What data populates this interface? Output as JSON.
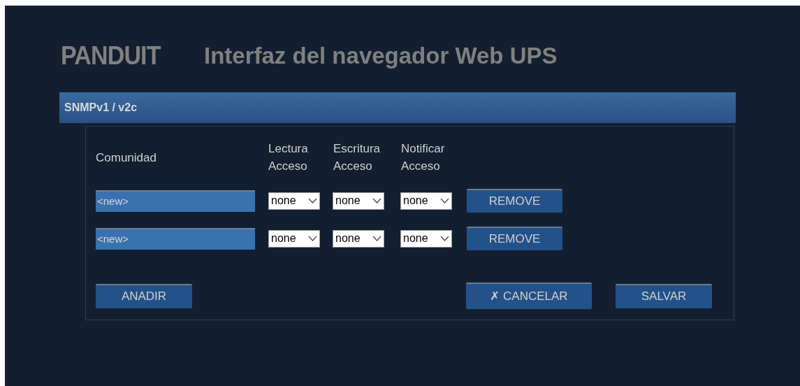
{
  "logo": "PANDUIT",
  "title": "Interfaz del navegador Web UPS",
  "section": {
    "title": "SNMPv1 / v2c"
  },
  "columns": [
    "Comunidad",
    "Lectura\nAcceso",
    "Escritura\nAcceso",
    "Notificar\nAcceso"
  ],
  "rows": [
    {
      "community": "<new>",
      "read": "none",
      "write": "none",
      "notify": "none",
      "button": "REMOVE"
    },
    {
      "community": "<new>",
      "read": "none",
      "write": "none",
      "notify": "none",
      "button": "REMOVE"
    }
  ],
  "buttons": {
    "add": "ANADIR",
    "cancel": "✗ CANCELAR",
    "save": "SALVAR"
  }
}
